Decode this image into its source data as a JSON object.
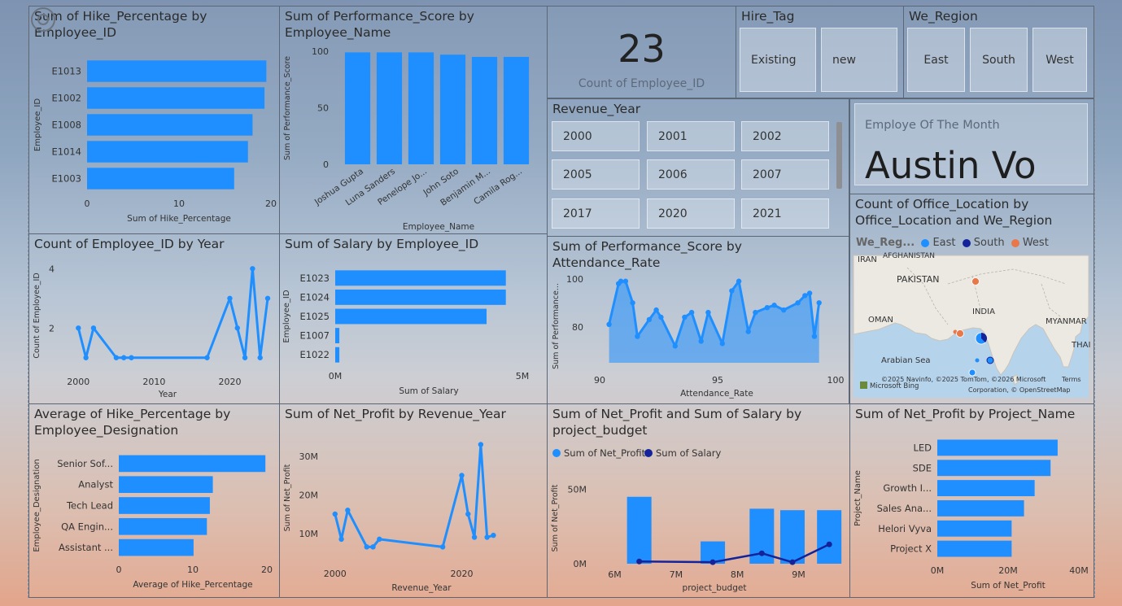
{
  "colors": {
    "bar": "#1f8fff",
    "dark": "#14239a",
    "west": "#e8784a"
  },
  "kpi": {
    "value": "23",
    "label": "Count of Employee_ID"
  },
  "hire_tag": {
    "title": "Hire_Tag",
    "options": [
      "Existing",
      "new"
    ]
  },
  "we_region": {
    "title": "We_Region",
    "options": [
      "East",
      "South",
      "West"
    ]
  },
  "revenue_year": {
    "title": "Revenue_Year",
    "options": [
      "2000",
      "2001",
      "2002",
      "2005",
      "2006",
      "2007",
      "2017",
      "2020",
      "2021"
    ]
  },
  "employee_of_month": {
    "label": "Employe Of The Month",
    "name": "Austin Vo"
  },
  "map": {
    "title": "Count of Office_Location by Office_Location and We_Region",
    "legend_title": "We_Reg...",
    "legend": [
      {
        "name": "East",
        "color": "#1f8fff"
      },
      {
        "name": "South",
        "color": "#14239a"
      },
      {
        "name": "West",
        "color": "#e8784a"
      }
    ],
    "labels": {
      "iran": "IRAN",
      "afghanistan": "AFGHANISTAN",
      "pakistan": "PAKISTAN",
      "india": "INDIA",
      "oman": "OMAN",
      "myanmar": "MYANMAR",
      "arabian_sea": "Arabian Sea",
      "thai": "THAI"
    },
    "credits": "©2025 Navinfo, ©2025 TomTom, ©2026 Microsoft",
    "credits_terms": "Terms",
    "credits_line2": "Corporation, © OpenStreetMap",
    "bing": "Microsoft Bing"
  },
  "chart_data": [
    {
      "id": "hike_by_emp",
      "type": "bar",
      "orientation": "horizontal",
      "title": "Sum of Hike_Percentage by Employee_ID",
      "xlabel": "Sum of Hike_Percentage",
      "ylabel": "Employee_ID",
      "categories": [
        "E1013",
        "E1002",
        "E1008",
        "E1014",
        "E1003"
      ],
      "values": [
        19.5,
        19.3,
        18,
        17.5,
        16
      ],
      "xlim": [
        0,
        20
      ],
      "xticks": [
        "0",
        "10",
        "20"
      ]
    },
    {
      "id": "perf_by_name",
      "type": "bar",
      "title": "Sum of Performance_Score by Employee_Name",
      "xlabel": "Employee_Name",
      "ylabel": "Sum of Performance_Score",
      "categories": [
        "Joshua Gupta",
        "Luna Sanders",
        "Penelope Jo...",
        "John Soto",
        "Benjamin M...",
        "Camila Rog..."
      ],
      "values": [
        99,
        99,
        99,
        97,
        95,
        95
      ],
      "ylim": [
        0,
        100
      ],
      "yticks": [
        "0",
        "50",
        "100"
      ]
    },
    {
      "id": "count_by_year",
      "type": "line",
      "title": "Count of Employee_ID by Year",
      "xlabel": "Year",
      "ylabel": "Count of Employee_ID",
      "x": [
        2000,
        2001,
        2002,
        2005,
        2006,
        2007,
        2017,
        2020,
        2021,
        2022,
        2023,
        2024,
        2025
      ],
      "values": [
        2,
        1,
        2,
        1,
        1,
        1,
        1,
        3,
        2,
        1,
        4,
        1,
        3
      ],
      "xlim": [
        1999,
        2025
      ],
      "ylim": [
        0.5,
        4.2
      ],
      "xticks": [
        "2000",
        "2010",
        "2020"
      ],
      "yticks": [
        "2",
        "4"
      ]
    },
    {
      "id": "salary_by_emp",
      "type": "bar",
      "orientation": "horizontal",
      "title": "Sum of Salary by Employee_ID",
      "xlabel": "Sum of Salary",
      "ylabel": "Employee_ID",
      "categories": [
        "E1023",
        "E1024",
        "E1025",
        "E1007",
        "E1022"
      ],
      "values": [
        6200000,
        6200000,
        5500000,
        150000,
        150000
      ],
      "xlim": [
        0,
        6800000
      ],
      "xticks": [
        "0M",
        "5M"
      ]
    },
    {
      "id": "perf_by_attendance",
      "type": "area",
      "title": "Sum of Performance_Score by Attendance_Rate",
      "xlabel": "Attendance_Rate",
      "ylabel": "Sum of Performance...",
      "x": [
        90.4,
        90.8,
        90.9,
        91.1,
        91.4,
        91.6,
        92.1,
        92.4,
        92.6,
        93.2,
        93.6,
        93.9,
        94.3,
        94.6,
        95.2,
        95.6,
        95.9,
        96.3,
        96.6,
        97.1,
        97.4,
        97.8,
        98.4,
        98.7,
        98.9,
        99.1,
        99.3
      ],
      "values": [
        81,
        98,
        99,
        99,
        90,
        76,
        83,
        87,
        84,
        72,
        84,
        86,
        74,
        86,
        73,
        95,
        99,
        78,
        86,
        88,
        89,
        87,
        90,
        93,
        94,
        76,
        90
      ],
      "xlim": [
        90,
        100
      ],
      "ylim": [
        65,
        104
      ],
      "xticks": [
        "90",
        "95",
        "100"
      ],
      "yticks": [
        "80",
        "100"
      ]
    },
    {
      "id": "avg_hike_by_designation",
      "type": "bar",
      "orientation": "horizontal",
      "title": "Average of Hike_Percentage by Employee_Designation",
      "xlabel": "Average of Hike_Percentage",
      "ylabel": "Employee_Designation",
      "categories": [
        "Senior Sof...",
        "Analyst",
        "Tech Lead",
        "QA Engin...",
        "Assistant ..."
      ],
      "values": [
        19.8,
        12.7,
        12.3,
        11.9,
        10.1
      ],
      "xlim": [
        0,
        20
      ],
      "xticks": [
        "0",
        "10",
        "20"
      ]
    },
    {
      "id": "profit_by_year",
      "type": "line",
      "title": "Sum of Net_Profit by Revenue_Year",
      "xlabel": "Revenue_Year",
      "ylabel": "Sum of Net_Profit",
      "x": [
        2000,
        2001,
        2002,
        2005,
        2006,
        2007,
        2017,
        2020,
        2021,
        2022,
        2023,
        2024,
        2025
      ],
      "values": [
        15000000,
        8500000,
        16000000,
        6500000,
        6500000,
        8500000,
        6500000,
        25000000,
        15000000,
        9000000,
        33000000,
        9000000,
        9500000
      ],
      "xlim": [
        1999,
        2027
      ],
      "ylim": [
        3000000,
        35000000
      ],
      "xticks": [
        "2000",
        "2020"
      ],
      "yticks": [
        "10M",
        "20M",
        "30M"
      ]
    },
    {
      "id": "profit_salary_by_budget",
      "type": "bar",
      "title": "Sum of Net_Profit and Sum of Salary by project_budget",
      "xlabel": "project_budget",
      "ylabel": "Sum of Net_Profit",
      "series": [
        {
          "name": "Sum of Net_Profit",
          "type": "bar",
          "x": [
            6400000,
            7600000,
            8400000,
            8900000,
            9500000
          ],
          "values": [
            45000000,
            15000000,
            37000000,
            36000000,
            36000000
          ]
        },
        {
          "name": "Sum of Salary",
          "type": "line",
          "x": [
            6400000,
            7600000,
            8400000,
            8900000,
            9500000
          ],
          "values": [
            1500000,
            1000000,
            7000000,
            1000000,
            13000000
          ]
        }
      ],
      "xlim": [
        5900000,
        9750000
      ],
      "ylim": [
        0,
        58000000
      ],
      "xticks": [
        "6M",
        "7M",
        "8M",
        "9M"
      ],
      "yticks": [
        "0M",
        "50M"
      ]
    },
    {
      "id": "profit_by_project",
      "type": "bar",
      "orientation": "horizontal",
      "title": "Sum of Net_Profit by Project_Name",
      "xlabel": "Sum of Net_Profit",
      "ylabel": "Project_Name",
      "categories": [
        "LED",
        "SDE",
        "Growth I...",
        "Sales Ana...",
        "Helori Vyva",
        "Project X"
      ],
      "values": [
        34000000,
        32000000,
        27500000,
        24500000,
        21000000,
        21000000
      ],
      "xlim": [
        0,
        40000000
      ],
      "xticks": [
        "0M",
        "20M",
        "40M"
      ]
    }
  ]
}
